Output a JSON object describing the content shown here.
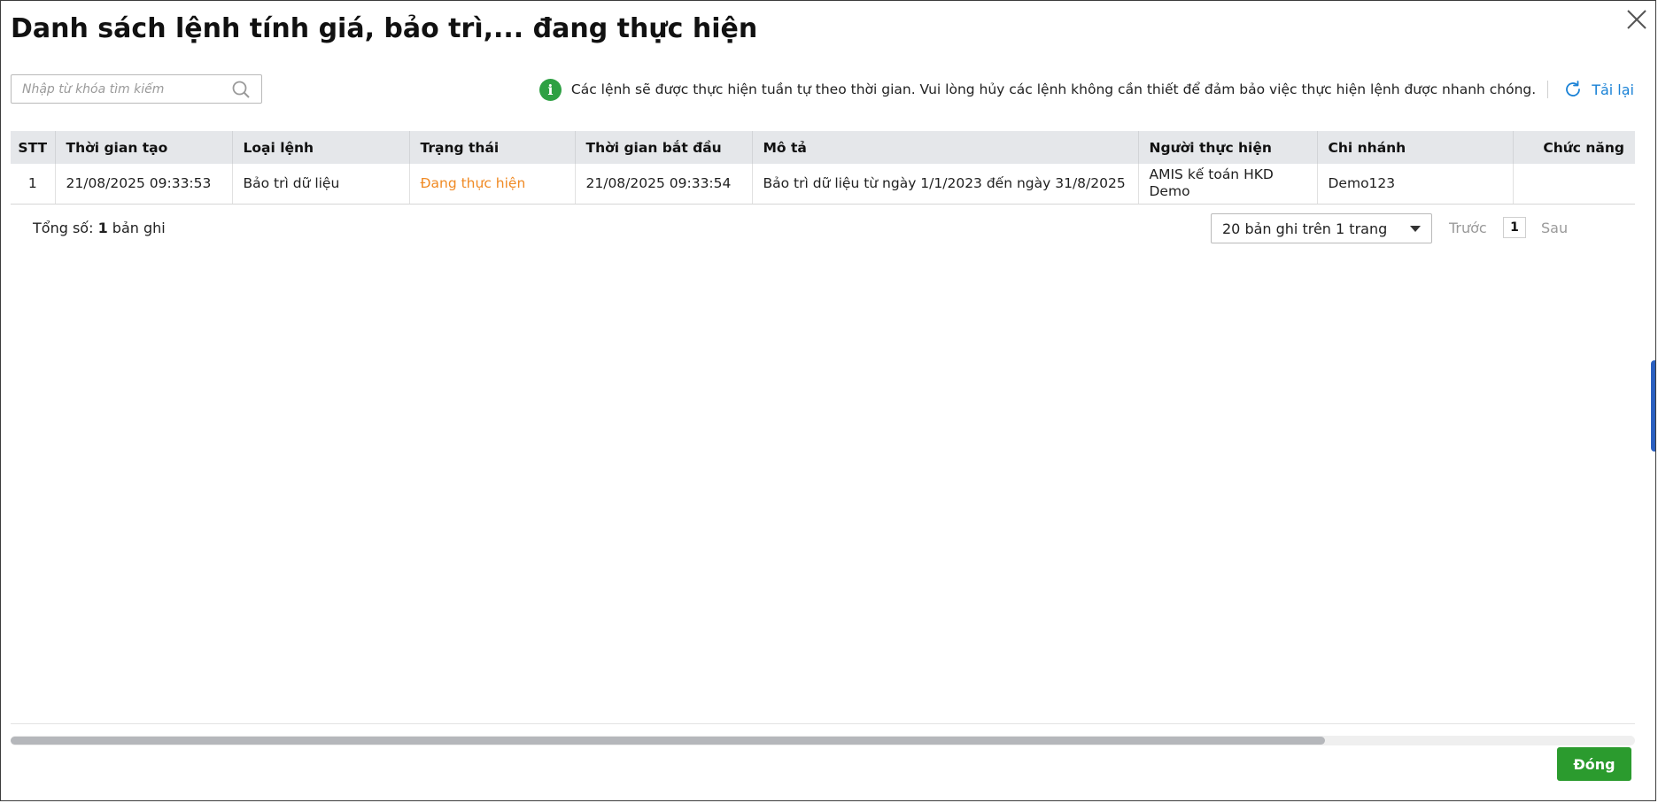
{
  "dialog": {
    "title": "Danh sách lệnh tính giá, bảo trì,... đang thực hiện",
    "close_icon": "close-icon"
  },
  "search": {
    "placeholder": "Nhập từ khóa tìm kiếm",
    "value": "",
    "icon": "search-icon"
  },
  "notice": {
    "icon": "info-icon",
    "icon_color": "#2ea043",
    "text": "Các lệnh sẽ được thực hiện tuần tự theo thời gian. Vui lòng hủy các lệnh không cần thiết để đảm bảo việc thực hiện lệnh được nhanh chóng.",
    "reload_label": "Tải lại",
    "reload_icon": "refresh-icon",
    "accent_color": "#1a82d6"
  },
  "table": {
    "columns": [
      "STT",
      "Thời gian tạo",
      "Loại lệnh",
      "Trạng thái",
      "Thời gian bắt đầu",
      "Mô tả",
      "Người thực hiện",
      "Chi nhánh",
      "Chức năng"
    ],
    "rows": [
      {
        "stt": "1",
        "created_at": "21/08/2025 09:33:53",
        "type": "Bảo trì dữ liệu",
        "status": "Đang thực hiện",
        "started_at": "21/08/2025 09:33:54",
        "description": "Bảo trì dữ liệu từ ngày 1/1/2023 đến ngày 31/8/2025",
        "executor": "AMIS kế toán HKD Demo",
        "branch": "Demo123",
        "actions": ""
      }
    ],
    "status_color": "#f08a24"
  },
  "footer": {
    "total_prefix": "Tổng số:",
    "total_count": "1",
    "total_suffix": "bản ghi",
    "page_size_label": "20 bản ghi trên 1 trang",
    "prev_label": "Trước",
    "current_page": "1",
    "next_label": "Sau"
  },
  "actions": {
    "close_label": "Đóng",
    "close_color": "#2b9b2e"
  }
}
